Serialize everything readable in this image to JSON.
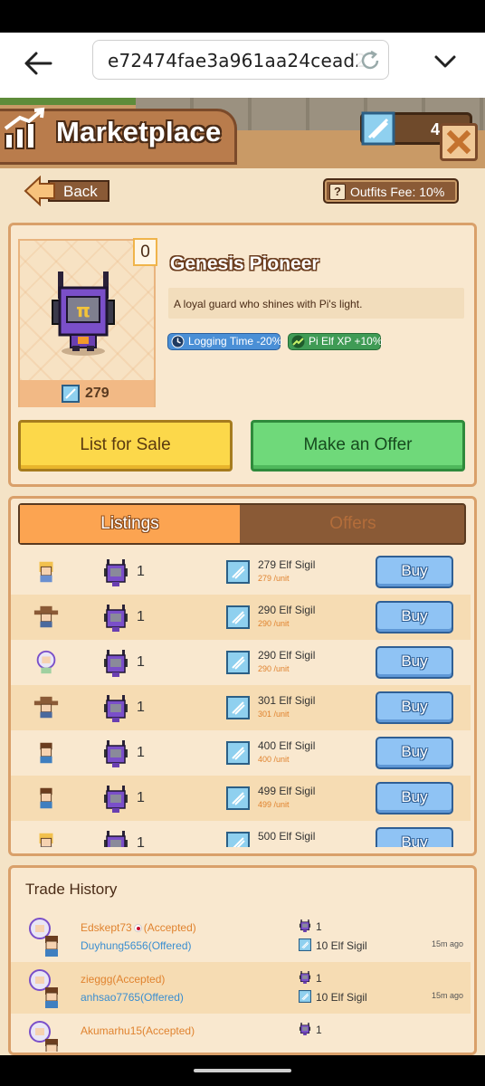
{
  "browser": {
    "url": "e72474fae3a961aa24cead2"
  },
  "header": {
    "title": "Marketplace",
    "currency_value": "4",
    "back_label": "Back",
    "fee_label": "Outfits Fee: 10%",
    "fee_icon_text": "?"
  },
  "item": {
    "name": "Genesis Pioneer",
    "description": "A loyal guard who shines with Pi's light.",
    "owned_count": "0",
    "price": "279",
    "perks": [
      {
        "label": "Logging Time -20%",
        "icon": "clock-icon"
      },
      {
        "label": "Pi Elf XP +10%",
        "icon": "trend-up-icon"
      }
    ],
    "list_button": "List for Sale",
    "offer_button": "Make an Offer"
  },
  "tabs": {
    "listings": "Listings",
    "offers": "Offers",
    "active": "listings"
  },
  "listings": [
    {
      "seller_avatar": "blonde-elf",
      "qty": "1",
      "price": "279 Elf Sigil",
      "unit": "279 /unit",
      "buy": "Buy"
    },
    {
      "seller_avatar": "cowboy-elf",
      "qty": "1",
      "price": "290 Elf Sigil",
      "unit": "290 /unit",
      "buy": "Buy"
    },
    {
      "seller_avatar": "astronaut-elf",
      "qty": "1",
      "price": "290 Elf Sigil",
      "unit": "290 /unit",
      "buy": "Buy"
    },
    {
      "seller_avatar": "cowboy-elf",
      "qty": "1",
      "price": "301 Elf Sigil",
      "unit": "301 /unit",
      "buy": "Buy"
    },
    {
      "seller_avatar": "brown-hair-elf",
      "qty": "1",
      "price": "400 Elf Sigil",
      "unit": "400 /unit",
      "buy": "Buy"
    },
    {
      "seller_avatar": "brown-hair-elf",
      "qty": "1",
      "price": "499 Elf Sigil",
      "unit": "499 /unit",
      "buy": "Buy"
    },
    {
      "seller_avatar": "blonde-elf",
      "qty": "1",
      "price": "500 Elf Sigil",
      "unit": "",
      "buy": "Buy"
    }
  ],
  "history": {
    "title": "Trade History",
    "rows": [
      {
        "seller": "Edskept73",
        "seller_flag": true,
        "seller_status": "(Accepted)",
        "buyer": "Duyhung5656(Offered)",
        "qty": "1",
        "price": "10 Elf Sigil",
        "time": "15m ago"
      },
      {
        "seller": "zieggg",
        "seller_flag": false,
        "seller_status": "(Accepted)",
        "buyer": "anhsao7765(Offered)",
        "qty": "1",
        "price": "10 Elf Sigil",
        "time": "15m ago"
      },
      {
        "seller": "Akumarhu15",
        "seller_flag": false,
        "seller_status": "(Accepted)",
        "buyer": "",
        "qty": "1",
        "price": "",
        "time": ""
      }
    ]
  },
  "colors": {
    "accent_orange": "#fca451",
    "buy_blue": "#8fc3f4",
    "offer_green": "#6fd97a",
    "list_yellow": "#fcd84a",
    "panel": "#f9e8cf"
  }
}
